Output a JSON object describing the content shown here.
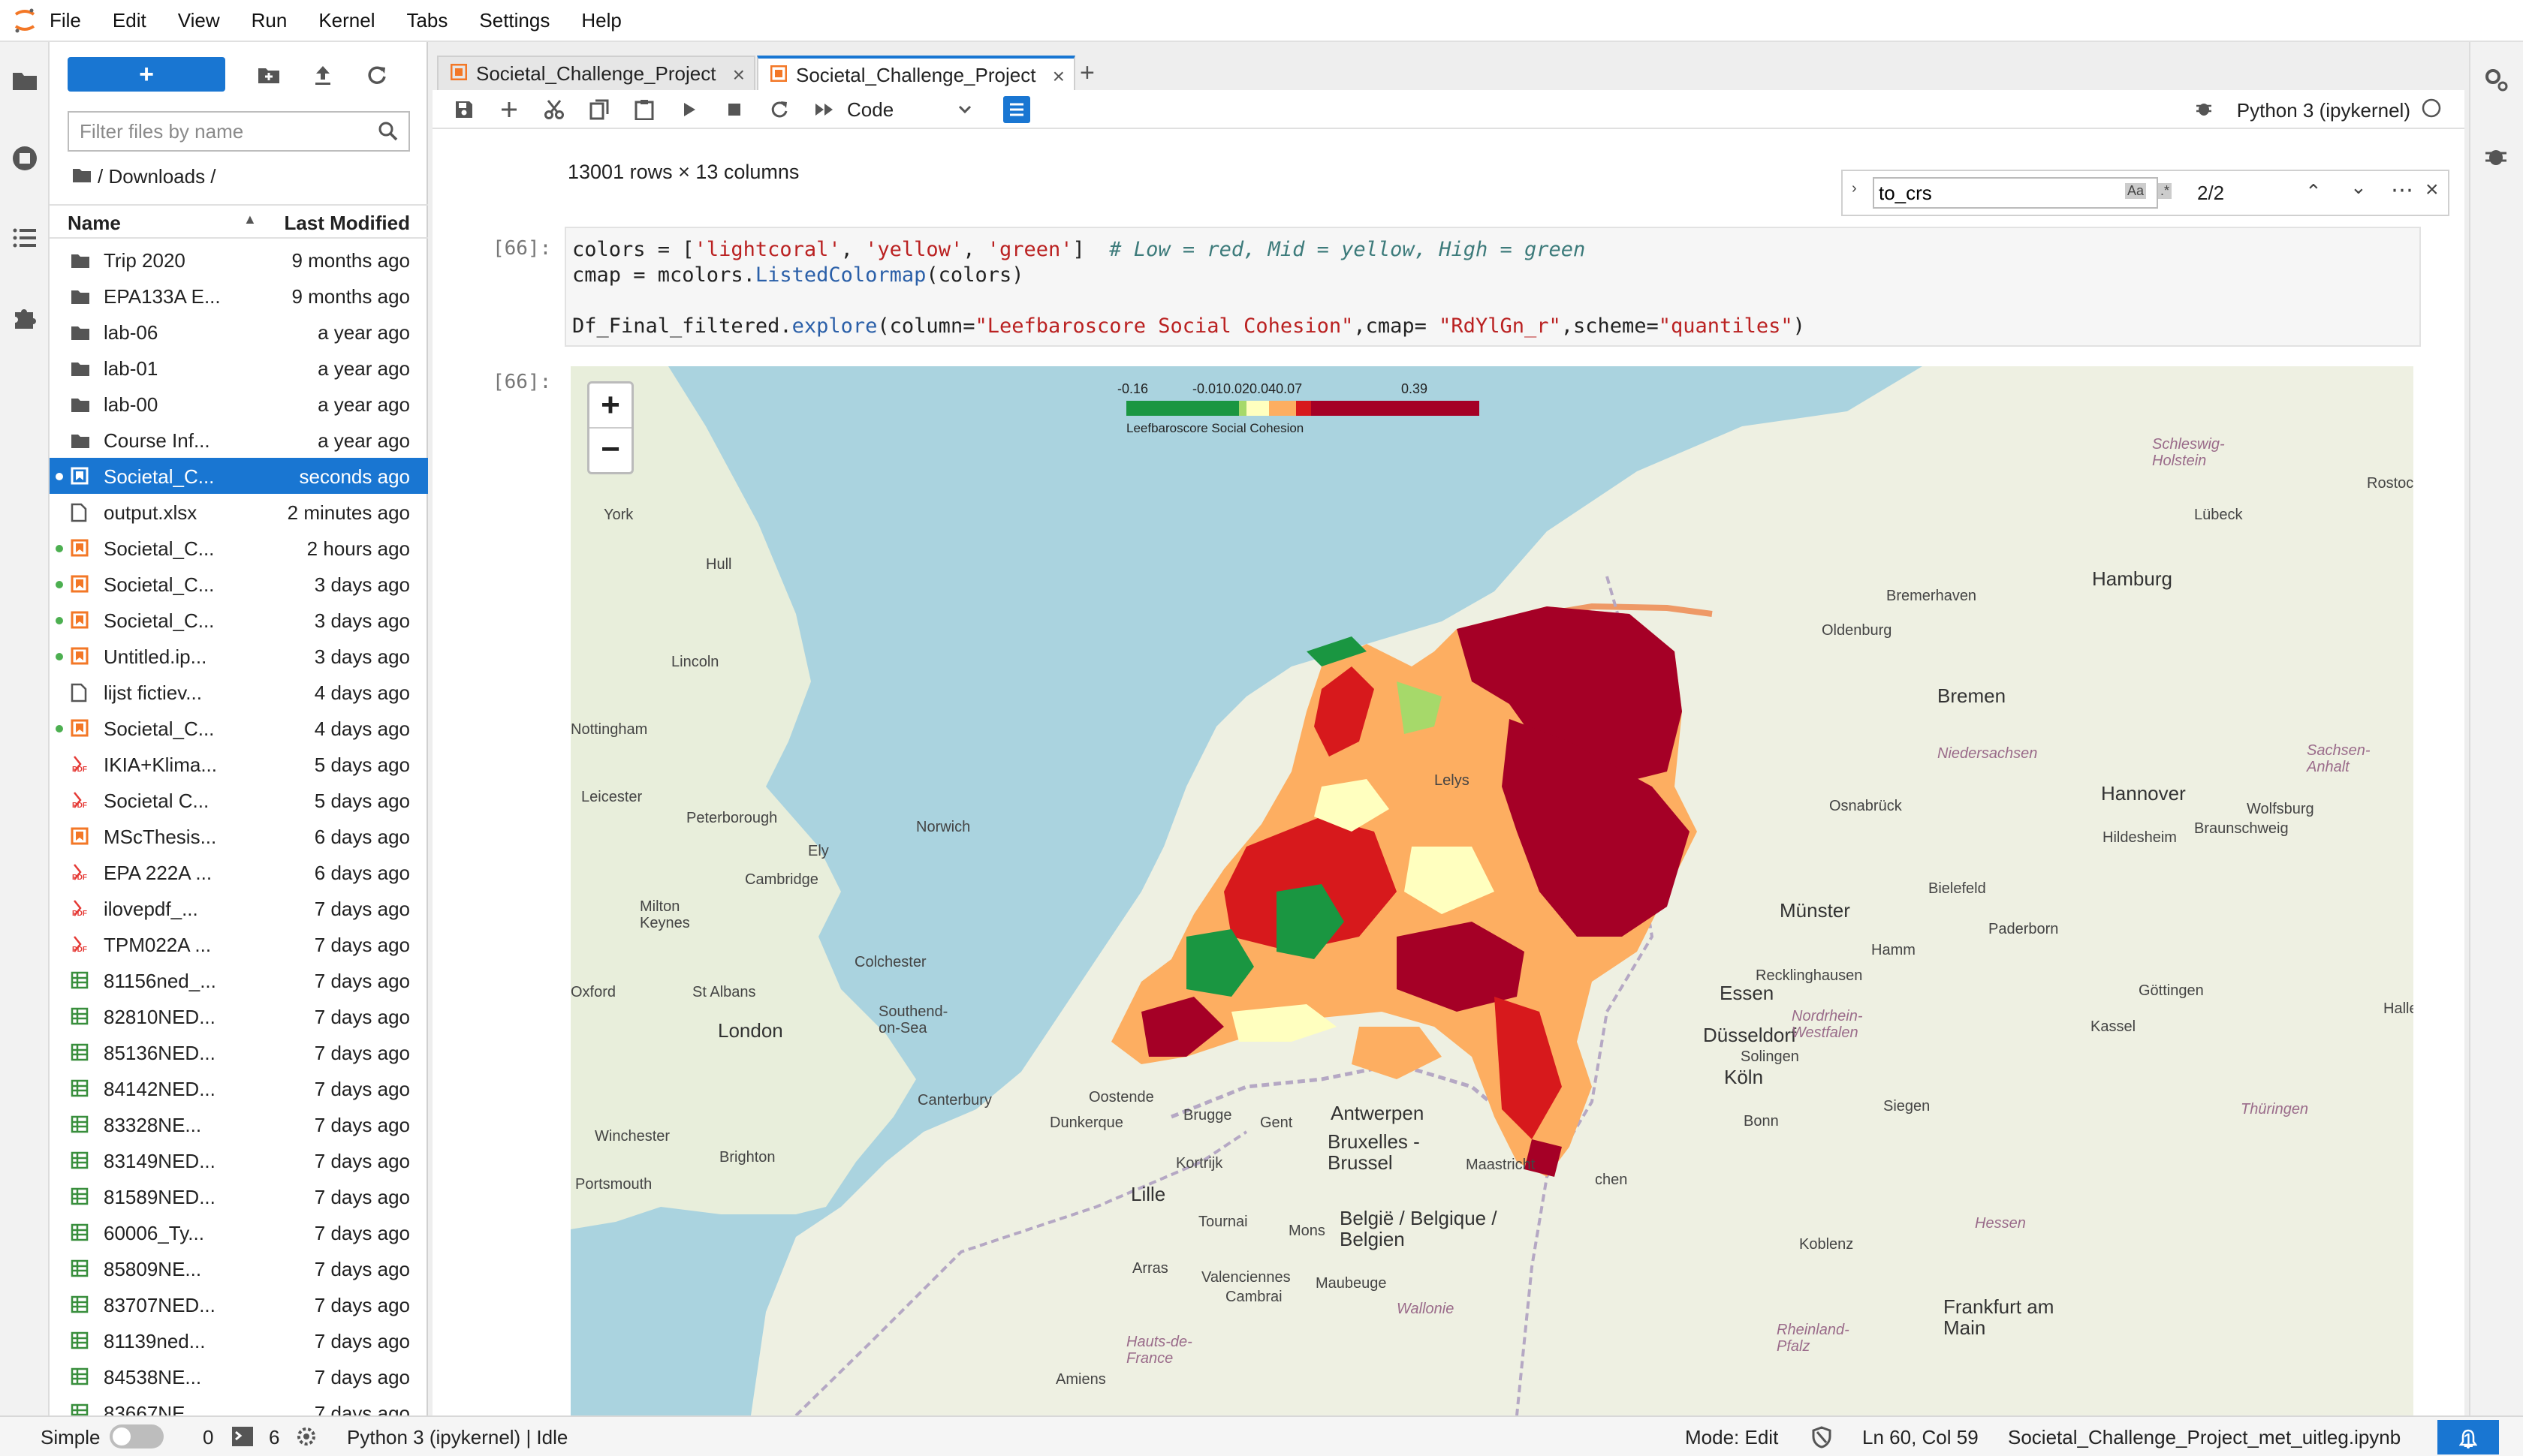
{
  "menubar": {
    "items": [
      "File",
      "Edit",
      "View",
      "Run",
      "Kernel",
      "Tabs",
      "Settings",
      "Help"
    ]
  },
  "filebrowser": {
    "new_label": "+",
    "search_placeholder": "Filter files by name",
    "breadcrumb": "/ Downloads /",
    "col_name": "Name",
    "col_modified": "Last Modified",
    "files": [
      {
        "name": "Trip 2020",
        "modified": "9 months ago",
        "type": "folder",
        "running": false,
        "selected": false
      },
      {
        "name": "EPA133A E...",
        "modified": "9 months ago",
        "type": "folder",
        "running": false,
        "selected": false
      },
      {
        "name": "lab-06",
        "modified": "a year ago",
        "type": "folder",
        "running": false,
        "selected": false
      },
      {
        "name": "lab-01",
        "modified": "a year ago",
        "type": "folder",
        "running": false,
        "selected": false
      },
      {
        "name": "lab-00",
        "modified": "a year ago",
        "type": "folder",
        "running": false,
        "selected": false
      },
      {
        "name": "Course Inf...",
        "modified": "a year ago",
        "type": "folder",
        "running": false,
        "selected": false
      },
      {
        "name": "Societal_C...",
        "modified": "seconds ago",
        "type": "notebook",
        "running": true,
        "selected": true
      },
      {
        "name": "output.xlsx",
        "modified": "2 minutes ago",
        "type": "file",
        "running": false,
        "selected": false
      },
      {
        "name": "Societal_C...",
        "modified": "2 hours ago",
        "type": "notebook",
        "running": true,
        "selected": false
      },
      {
        "name": "Societal_C...",
        "modified": "3 days ago",
        "type": "notebook",
        "running": true,
        "selected": false
      },
      {
        "name": "Societal_C...",
        "modified": "3 days ago",
        "type": "notebook",
        "running": true,
        "selected": false
      },
      {
        "name": "Untitled.ip...",
        "modified": "3 days ago",
        "type": "notebook",
        "running": true,
        "selected": false
      },
      {
        "name": "lijst fictiev...",
        "modified": "4 days ago",
        "type": "file",
        "running": false,
        "selected": false
      },
      {
        "name": "Societal_C...",
        "modified": "4 days ago",
        "type": "notebook",
        "running": true,
        "selected": false
      },
      {
        "name": "IKIA+Klima...",
        "modified": "5 days ago",
        "type": "pdf",
        "running": false,
        "selected": false
      },
      {
        "name": "Societal C...",
        "modified": "5 days ago",
        "type": "pdf",
        "running": false,
        "selected": false
      },
      {
        "name": "MScThesis...",
        "modified": "6 days ago",
        "type": "notebook",
        "running": false,
        "selected": false
      },
      {
        "name": "EPA 222A ...",
        "modified": "6 days ago",
        "type": "pdf",
        "running": false,
        "selected": false
      },
      {
        "name": "ilovepdf_...",
        "modified": "7 days ago",
        "type": "pdf",
        "running": false,
        "selected": false
      },
      {
        "name": "TPM022A ...",
        "modified": "7 days ago",
        "type": "pdf",
        "running": false,
        "selected": false
      },
      {
        "name": "81156ned_...",
        "modified": "7 days ago",
        "type": "csv",
        "running": false,
        "selected": false
      },
      {
        "name": "82810NED...",
        "modified": "7 days ago",
        "type": "csv",
        "running": false,
        "selected": false
      },
      {
        "name": "85136NED...",
        "modified": "7 days ago",
        "type": "csv",
        "running": false,
        "selected": false
      },
      {
        "name": "84142NED...",
        "modified": "7 days ago",
        "type": "csv",
        "running": false,
        "selected": false
      },
      {
        "name": "83328NE...",
        "modified": "7 days ago",
        "type": "csv",
        "running": false,
        "selected": false
      },
      {
        "name": "83149NED...",
        "modified": "7 days ago",
        "type": "csv",
        "running": false,
        "selected": false
      },
      {
        "name": "81589NED...",
        "modified": "7 days ago",
        "type": "csv",
        "running": false,
        "selected": false
      },
      {
        "name": "60006_Ty...",
        "modified": "7 days ago",
        "type": "csv",
        "running": false,
        "selected": false
      },
      {
        "name": "85809NE...",
        "modified": "7 days ago",
        "type": "csv",
        "running": false,
        "selected": false
      },
      {
        "name": "83707NED...",
        "modified": "7 days ago",
        "type": "csv",
        "running": false,
        "selected": false
      },
      {
        "name": "81139ned...",
        "modified": "7 days ago",
        "type": "csv",
        "running": false,
        "selected": false
      },
      {
        "name": "84538NE...",
        "modified": "7 days ago",
        "type": "csv",
        "running": false,
        "selected": false
      },
      {
        "name": "83667NE...",
        "modified": "7 days ago",
        "type": "csv",
        "running": false,
        "selected": false
      }
    ]
  },
  "tabs": [
    {
      "label": "Societal_Challenge_Project",
      "active": false
    },
    {
      "label": "Societal_Challenge_Project",
      "active": true
    }
  ],
  "toolbar": {
    "cell_type": "Code",
    "kernel": "Python 3 (ipykernel)"
  },
  "find": {
    "query": "to_crs",
    "count": "2/2"
  },
  "notebook": {
    "output_rows": "13001 rows × 13 columns",
    "prompt_cell": "[66]:",
    "prompt_output": "[66]:",
    "code": {
      "line1_a": "colors = [",
      "line1_s1": "'lightcoral'",
      "line1_c1": ", ",
      "line1_s2": "'yellow'",
      "line1_c2": ", ",
      "line1_s3": "'green'",
      "line1_b": "]  ",
      "line1_comment": "# Low = red, Mid = yellow, High = green",
      "line2_a": "cmap = mcolors.",
      "line2_fn": "ListedColormap",
      "line2_b": "(colors)",
      "line3_a": "Df_Final_filtered.",
      "line3_fn": "explore",
      "line3_b": "(column=",
      "line3_s1": "\"Leefbaroscore Social Cohesion\"",
      "line3_c": ",cmap= ",
      "line3_s2": "\"RdYlGn_r\"",
      "line3_d": ",scheme=",
      "line3_s3": "\"quantiles\"",
      "line3_e": ")"
    }
  },
  "map": {
    "zoom_in": "+",
    "zoom_out": "−",
    "legend_min": "-0.16",
    "legend_mid": "-0.010.020.040.07",
    "legend_max": "0.39",
    "legend_title": "Leefbaroscore Social Cohesion",
    "legend_colors": [
      "#1a9641",
      "#a6d96a",
      "#ffffbf",
      "#fdae61",
      "#d7191c",
      "#a50026"
    ],
    "labels": {
      "york": "York",
      "hull": "Hull",
      "lincoln": "Lincoln",
      "nottingham": "Nottingham",
      "leicester": "Leicester",
      "peterborough": "Peterborough",
      "norwich": "Norwich",
      "ely": "Ely",
      "cambridge": "Cambridge",
      "milton_keynes": "Milton\nKeynes",
      "oxford": "Oxford",
      "st_albans": "St Albans",
      "colchester": "Colchester",
      "southend": "Southend-\non-Sea",
      "london": "London",
      "canterbury": "Canterbury",
      "winchester": "Winchester",
      "brighton": "Brighton",
      "portsmouth": "Portsmouth",
      "ostende": "Oostende",
      "dunkerque": "Dunkerque",
      "brugge": "Brugge",
      "gent": "Gent",
      "antwerpen": "Antwerpen",
      "bruxelles": "Bruxelles -\nBrussel",
      "kortrijk": "Kortrijk",
      "lille": "Lille",
      "tournai": "Tournai",
      "mons": "Mons",
      "arras": "Arras",
      "valenciennes": "Valenciennes",
      "cambrai": "Cambrai",
      "maubeuge": "Maubeuge",
      "wallonie": "Wallonie",
      "belgie": "België / Belgique /\nBelgien",
      "hauts_de_france": "Hauts-de-\nFrance",
      "amiens": "Amiens",
      "maastricht": "Maastricht",
      "hamburg": "Hamburg",
      "bremen": "Bremen",
      "bremerhaven": "Bremerhaven",
      "oldenburg": "Oldenburg",
      "niedersachsen": "Niedersachsen",
      "hannover": "Hannover",
      "wolfsburg": "Wolfsburg",
      "braunschweig": "Braunschweig",
      "osnabruck": "Osnabrück",
      "bielefeld": "Bielefeld",
      "hildesheim": "Hildesheim",
      "munster": "Münster",
      "paderborn": "Paderborn",
      "hamm": "Hamm",
      "essen": "Essen",
      "dusseldorf": "Düsseldorf",
      "nrw": "Nordrhein-\nWestfalen",
      "kassel": "Kassel",
      "gottingen": "Göttingen",
      "koln": "Köln",
      "bonn": "Bonn",
      "siegen": "Siegen",
      "solingen": "Solingen",
      "recklinghausen": "Recklinghausen",
      "hessen": "Hessen",
      "thuringen": "Thüringen",
      "koblenz": "Koblenz",
      "frankfurt": "Frankfurt am\nMain",
      "rheinland": "Rheinland-\nPfalz",
      "lubeck": "Lübeck",
      "rostock": "Rostoc",
      "schleswig": "Schleswig-\nHolstein",
      "sachsen_anhalt": "Sachsen-\nAnhalt",
      "halle": "Halle (S",
      "aachen": "chen",
      "lelystad": "Lelys"
    }
  },
  "statusbar": {
    "mode_simple": "Simple",
    "terminals": "0",
    "kernels": "6",
    "kernel_status": "Python 3 (ipykernel) | Idle",
    "mode": "Mode: Edit",
    "cursor": "Ln 60, Col 59",
    "filename": "Societal_Challenge_Project_met_uitleg.ipynb",
    "notifications": "1"
  }
}
